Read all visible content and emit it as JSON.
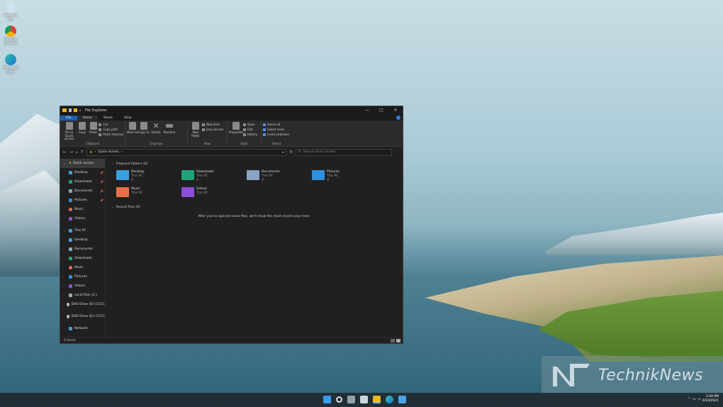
{
  "desktop": {
    "icons": [
      {
        "label": "Recycle Bin",
        "icon": "recycle-bin-icon"
      },
      {
        "label": "Google Chrome",
        "icon": "chrome-icon"
      },
      {
        "label": "Microsoft Edge",
        "icon": "edge-icon"
      }
    ]
  },
  "window": {
    "title": "File Explorer",
    "controls": {
      "minimize": "—",
      "maximize": "□",
      "close": "✕"
    }
  },
  "tabs": [
    "File",
    "Home",
    "Share",
    "View"
  ],
  "ribbon": {
    "clipboard": {
      "name": "Clipboard",
      "pin": "Pin to Quick access",
      "copy": "Copy",
      "paste": "Paste",
      "cut": "Cut",
      "copy_path": "Copy path",
      "paste_shortcut": "Paste shortcut"
    },
    "organize": {
      "name": "Organize",
      "move_to": "Move to",
      "copy_to": "Copy to",
      "delete": "Delete",
      "rename": "Rename"
    },
    "new": {
      "name": "New",
      "new_folder": "New folder",
      "new_item": "New item",
      "easy_access": "Easy access"
    },
    "open": {
      "name": "Open",
      "properties": "Properties",
      "open": "Open",
      "edit": "Edit",
      "history": "History"
    },
    "select": {
      "name": "Select",
      "select_all": "Select all",
      "select_none": "Select none",
      "invert": "Invert selection"
    }
  },
  "address": {
    "path": "Quick access",
    "search_placeholder": "Search Quick access"
  },
  "nav": {
    "quick_access": "Quick access",
    "quick_items": [
      "Desktop",
      "Downloads",
      "Documents",
      "Pictures",
      "Music",
      "Videos"
    ],
    "this_pc": "This PC",
    "pc_items": [
      "Desktop",
      "Documents",
      "Downloads",
      "Music",
      "Pictures",
      "Videos",
      "Local Disk (C:)",
      "DVD Drive (D:) CCCC"
    ],
    "dvd": "DVD Drive (D:) CCCC",
    "network": "Network"
  },
  "content": {
    "frequent_header": "Frequent folders (6)",
    "folders": [
      {
        "name": "Desktop",
        "sub": "This PC",
        "color": "#3aa0e0"
      },
      {
        "name": "Downloads",
        "sub": "This PC",
        "color": "#1fa37a"
      },
      {
        "name": "Documents",
        "sub": "This PC",
        "color": "#8aa4c4"
      },
      {
        "name": "Pictures",
        "sub": "This PC",
        "color": "#2f8fe0"
      },
      {
        "name": "Music",
        "sub": "This PC",
        "color": "#e8704a"
      },
      {
        "name": "Videos",
        "sub": "This PC",
        "color": "#8a4fd8"
      }
    ],
    "recent_header": "Recent files (0)",
    "recent_message": "After you've opened some files, we'll show the most recent ones here."
  },
  "status": {
    "items": "6 items"
  },
  "taskbar": {
    "time": "1:00 PM",
    "date": "6/19/2021"
  },
  "watermark": {
    "text": "TechnikNews"
  }
}
